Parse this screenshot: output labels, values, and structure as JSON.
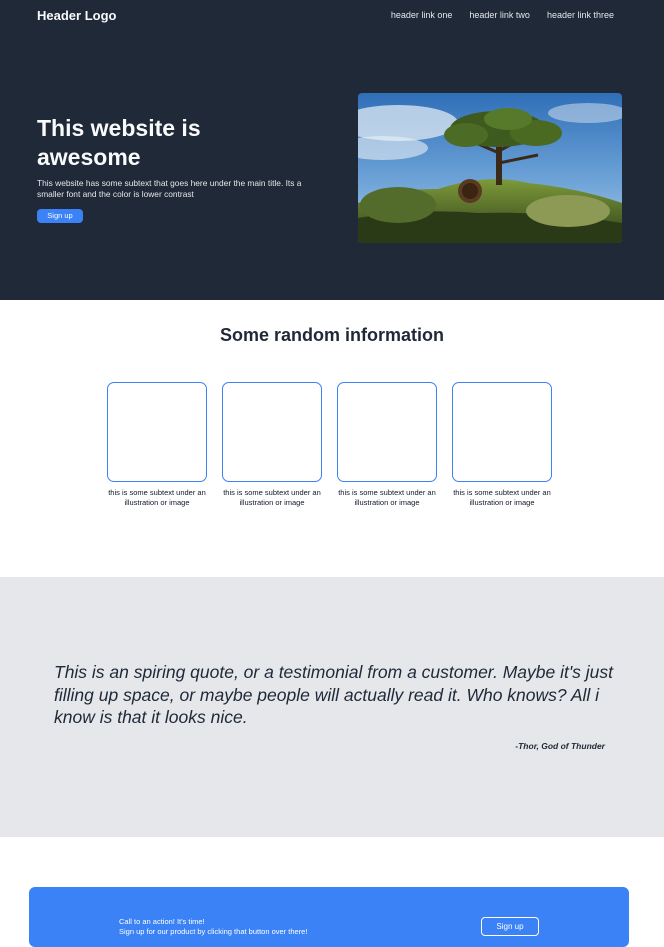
{
  "header": {
    "logo": "Header Logo",
    "links": [
      "header link one",
      "header link two",
      "header link three"
    ]
  },
  "hero": {
    "title": "This website is awesome",
    "subtext": "This website has some subtext that goes here under the main title. Its a smaller font and the color is lower contrast",
    "cta_label": "Sign up",
    "image": "hillside-house-tree-photo"
  },
  "info": {
    "title": "Some random information",
    "cards": [
      {
        "text": "this is some subtext under an illustration or image"
      },
      {
        "text": "this is some subtext under an illustration or image"
      },
      {
        "text": "this is some subtext under an illustration or image"
      },
      {
        "text": "this is some subtext under an illustration or image"
      }
    ]
  },
  "quote": {
    "text": "This is an spiring quote, or a testimonial from a customer. Maybe it's just filling up space, or maybe people will actually read it. Who knows? All i know is that it looks nice.",
    "author": "-Thor, God of Thunder"
  },
  "cta": {
    "line1": "Call to an action! It's time!",
    "line2": "Sign up for our product by clicking that button over there!",
    "button_label": "Sign up"
  },
  "colors": {
    "dark": "#1f2937",
    "accent": "#3b82f6",
    "light_gray": "#e5e7eb"
  }
}
